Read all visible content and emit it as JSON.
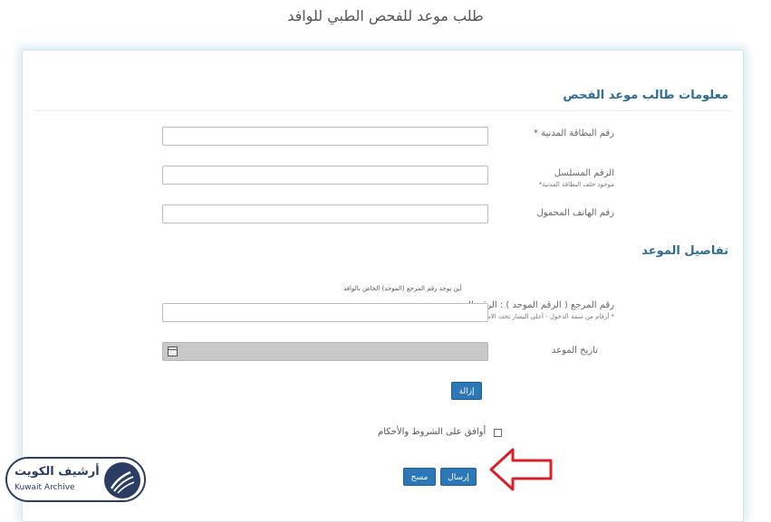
{
  "page_title": "طلب موعد للفحص الطبي للوافد",
  "section_applicant": {
    "title": "معلومات طالب موعد الفحص"
  },
  "fields": {
    "civil_id": {
      "label": "رقم البطاقة المدنية *",
      "value": ""
    },
    "serial": {
      "label": "الرقم المسلسل",
      "sub": "موجود خلف البطاقة المدنية*",
      "value": ""
    },
    "mobile": {
      "label": "رقم الهاتف المحمول",
      "value": ""
    }
  },
  "section_appointment": {
    "title": "تفاصيل الموعد"
  },
  "reference": {
    "hint": "أين يوجد رقم المرجع (الموحد) الخاص بالوافد",
    "label": "رقم المرجع ( الرقم الموحد ) : الرقم المدني",
    "sub": "* أرقام من سمة الدخول - أعلى اليسار تحت الاسم الإنجليزي",
    "value": ""
  },
  "date": {
    "label": "تاريخ الموعد",
    "value": ""
  },
  "buttons": {
    "remove": "إزالة",
    "submit": "إرسال",
    "clear": "مسح"
  },
  "terms": {
    "label": "أوافق على الشروط والأحكام",
    "checked": false
  },
  "logo": {
    "title": "أرشيف الكويت",
    "subtitle": "Kuwait Archive"
  },
  "colors": {
    "accent": "#2c77b8",
    "heading": "#2f6d94",
    "arrow": "#d9202a",
    "logo": "#2b3d63"
  },
  "icons": {
    "date_picker": "calendar-icon",
    "callout": "left-arrow-icon"
  }
}
